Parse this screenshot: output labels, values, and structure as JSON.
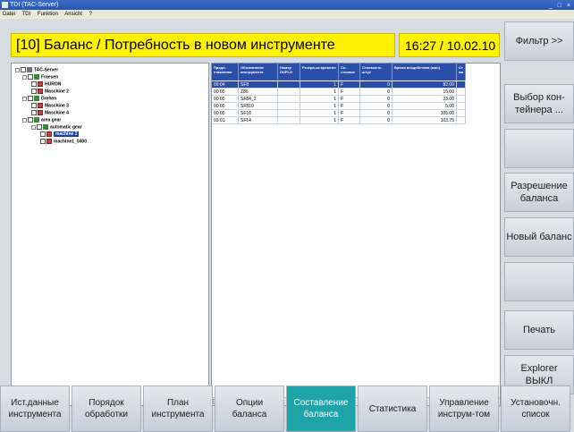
{
  "window": {
    "title": "TDI (TAC-Server)",
    "controls": "_ □ ×"
  },
  "menu": [
    "Datei",
    "TDI",
    "Funktion",
    "Ansicht",
    "?"
  ],
  "header": {
    "title": "[10] Баланс / Потребность в новом инструменте",
    "clock": "16:27 / 10.02.10"
  },
  "tree": [
    {
      "label": "TAC-Server",
      "icon": "server-icon",
      "kind": "server",
      "level": 0,
      "selected": false
    },
    {
      "label": "Fraesen",
      "icon": "group-icon",
      "kind": "group",
      "level": 1,
      "selected": false
    },
    {
      "label": "HURON",
      "icon": "machine-icon",
      "kind": "machine",
      "level": 2,
      "selected": false
    },
    {
      "label": "Maschine 2",
      "icon": "machine-icon",
      "kind": "machine",
      "level": 2,
      "selected": false
    },
    {
      "label": "Drehen",
      "icon": "group-icon",
      "kind": "group",
      "level": 1,
      "selected": false
    },
    {
      "label": "Maschine 3",
      "icon": "machine-icon",
      "kind": "machine",
      "level": 2,
      "selected": false
    },
    {
      "label": "Maschine 4",
      "icon": "machine-icon",
      "kind": "machine",
      "level": 2,
      "selected": false
    },
    {
      "label": "area gear",
      "icon": "group-icon",
      "kind": "group",
      "level": 1,
      "selected": false
    },
    {
      "label": "automatic gear",
      "icon": "group-icon",
      "kind": "group",
      "level": 2,
      "selected": false
    },
    {
      "label": "machine 1",
      "icon": "machine-icon",
      "kind": "machine",
      "level": 3,
      "selected": true
    },
    {
      "label": "machine1_0400",
      "icon": "machine-icon",
      "kind": "machine",
      "level": 3,
      "selected": false
    }
  ],
  "table": {
    "columns": [
      "Предо-ставление",
      "Обозначение инструмента",
      "Номер DUPLO",
      "Резерв-ка времени",
      "Со-стояние",
      "Стоимость штук",
      "Время воздействия (мин)",
      "Ст мо"
    ],
    "rows": [
      [
        "00:04",
        "SF8",
        "",
        "1",
        "F",
        "0",
        "82.00",
        ""
      ],
      [
        "00:05",
        "Z86",
        "",
        "1",
        "F",
        "0",
        "15.00",
        ""
      ],
      [
        "00:05",
        "SF84_2",
        "",
        "1",
        "F",
        "0",
        "23.00",
        ""
      ],
      [
        "00:05",
        "SF810",
        "",
        "1",
        "F",
        "0",
        "5.00",
        ""
      ],
      [
        "00:05",
        "SF10",
        "",
        "1",
        "F",
        "0",
        "305.00",
        ""
      ],
      [
        "03:01",
        "SF14",
        "",
        "1",
        "F",
        "0",
        "103.75",
        ""
      ]
    ],
    "selected_row": 0
  },
  "softkeys_vertical": [
    "Фильтр >>",
    "Выбор кон-\nтейнера ...",
    "",
    "Разрешение\nбаланса",
    "Новый баланс",
    "",
    "Печать",
    "Explorer\nВЫКЛ"
  ],
  "softkeys_horizontal": [
    {
      "label": "Ист.данные\nинструмента",
      "active": false
    },
    {
      "label": "Порядок\nобработки",
      "active": false
    },
    {
      "label": "План\nинструмента",
      "active": false
    },
    {
      "label": "Опции\nбаланса",
      "active": false
    },
    {
      "label": "Составление\nбаланса",
      "active": true
    },
    {
      "label": "Статистика",
      "active": false
    },
    {
      "label": "Управление\nинструм-том",
      "active": false
    },
    {
      "label": "Установочн.\nсписок",
      "active": false
    }
  ],
  "colors": {
    "header_yellow": "#fff200",
    "table_header": "#2b4ea8",
    "selection": "#1b3faa",
    "active_key": "#1da3a8"
  }
}
